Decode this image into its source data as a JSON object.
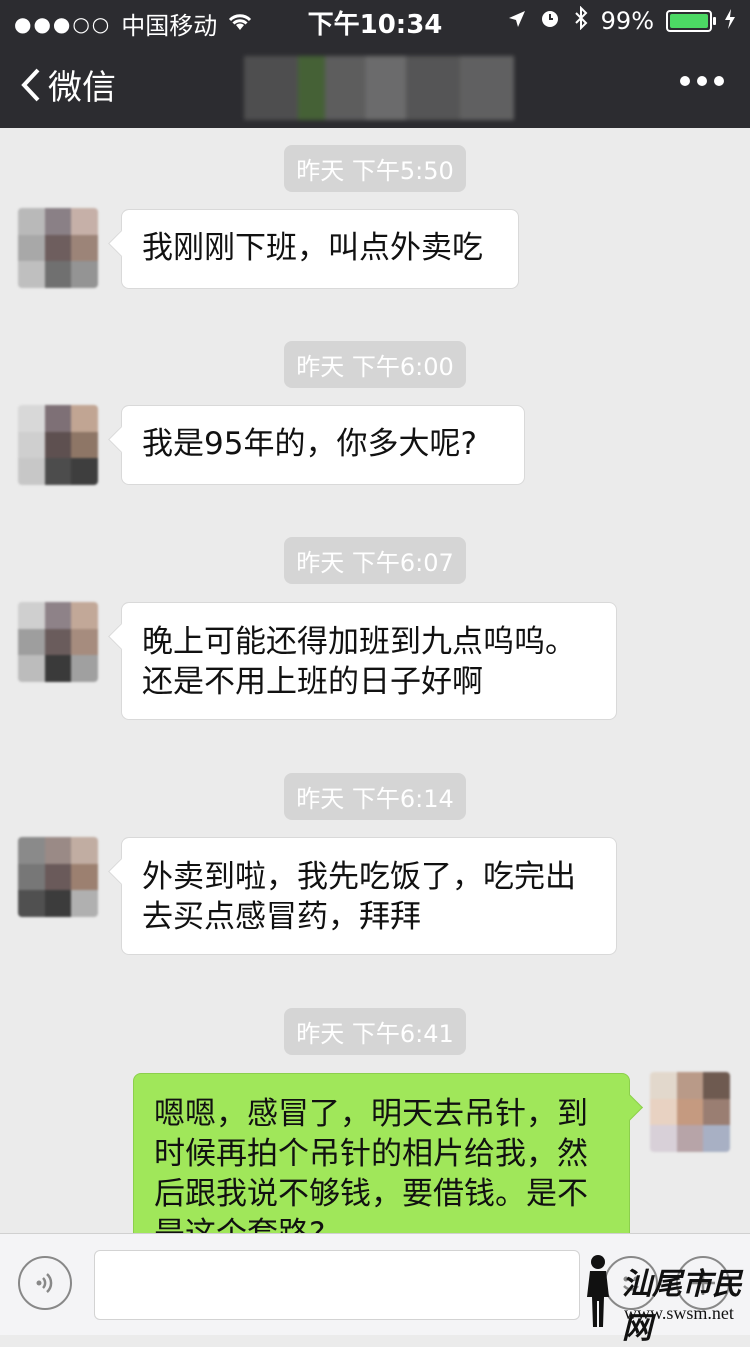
{
  "status_bar": {
    "carrier": "中国移动",
    "time": "下午10:34",
    "battery_text": "99%",
    "battery_level": 0.99
  },
  "nav": {
    "back_label": "微信"
  },
  "messages": [
    {
      "timestamp": "昨天 下午5:50",
      "side": "left",
      "lines": [
        "我刚刚下班，叫点外卖吃"
      ]
    },
    {
      "timestamp": "昨天 下午6:00",
      "side": "left",
      "lines": [
        "我是95年的，你多大呢?"
      ]
    },
    {
      "timestamp": "昨天 下午6:07",
      "side": "left",
      "lines": [
        "晚上可能还得加班到九点呜呜。",
        "还是不用上班的日子好啊"
      ]
    },
    {
      "timestamp": "昨天 下午6:14",
      "side": "left",
      "lines": [
        "外卖到啦，我先吃饭了，吃完出",
        "去买点感冒药，拜拜"
      ]
    },
    {
      "timestamp": "昨天 下午6:41",
      "side": "right",
      "lines": [
        "嗯嗯，感冒了，明天去吊针，到",
        "时候再拍个吊针的相片给我，然",
        "后跟我说不够钱，要借钱。是不",
        "是这个套路?"
      ]
    }
  ],
  "watermark": {
    "site_name": "汕尾市民网",
    "url": "www.swsm.net"
  },
  "colors": {
    "topbar": "#2c2c30",
    "chat_bg": "#ebebeb",
    "my_bubble": "#a0e75a"
  }
}
